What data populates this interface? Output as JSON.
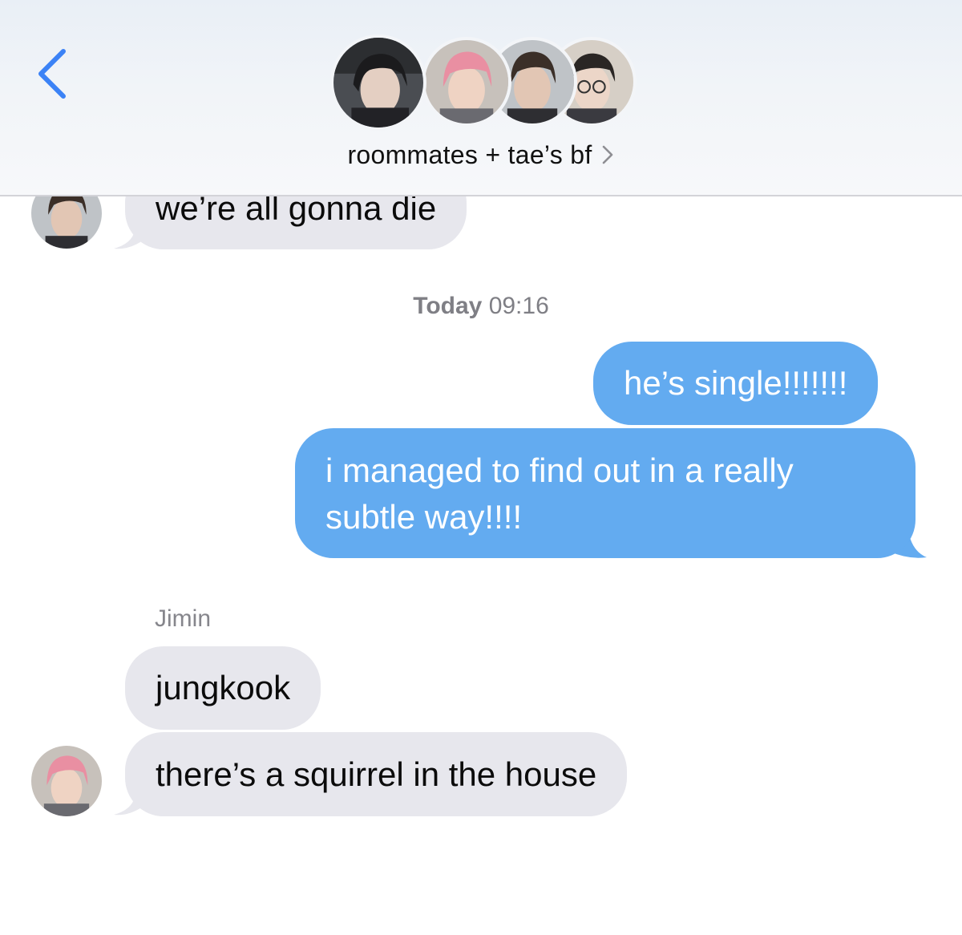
{
  "header": {
    "group_title": "roommates + tae’s bf",
    "participants": [
      {
        "icon": "avatar-photo-dark-hair"
      },
      {
        "icon": "avatar-photo-pink-hair"
      },
      {
        "icon": "avatar-photo-brown-hair"
      },
      {
        "icon": "avatar-photo-glasses"
      }
    ],
    "back_icon": "chevron-left-icon",
    "title_chevron_icon": "chevron-right-icon"
  },
  "colors": {
    "accent": "#3b82f6",
    "outgoing_bubble": "#63abf0",
    "incoming_bubble": "#e7e7ed",
    "timestamp_text": "#7f7f85"
  },
  "conversation": {
    "timestamp": {
      "day": "Today",
      "time": "09:16"
    },
    "messages": [
      {
        "direction": "incoming",
        "text": "we’re all gonna die"
      },
      {
        "direction": "outgoing",
        "text": "he’s single!!!!!!!"
      },
      {
        "direction": "outgoing",
        "text": "i managed to find out in a really subtle way!!!!"
      },
      {
        "direction": "incoming",
        "sender": "Jimin",
        "text": "jungkook"
      },
      {
        "direction": "incoming",
        "text": "there’s a squirrel in the house"
      }
    ]
  }
}
